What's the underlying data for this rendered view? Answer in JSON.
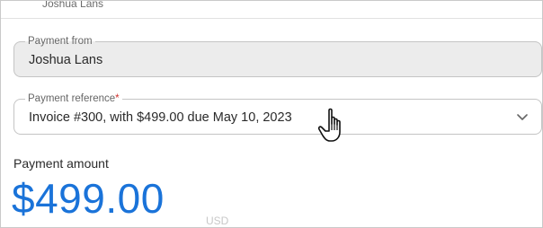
{
  "header": {
    "name": "Joshua Lans"
  },
  "payment_from": {
    "label": "Payment from",
    "value": "Joshua Lans"
  },
  "payment_reference": {
    "label": "Payment reference",
    "required_marker": "*",
    "value": "Invoice #300, with $499.00 due May 10, 2023",
    "icon": "chevron-down-icon"
  },
  "payment_amount": {
    "label": "Payment amount",
    "value": "$499.00",
    "currency": "USD",
    "accent_color": "#1a73d9"
  },
  "cursor": {
    "icon": "hand-pointer-icon"
  }
}
